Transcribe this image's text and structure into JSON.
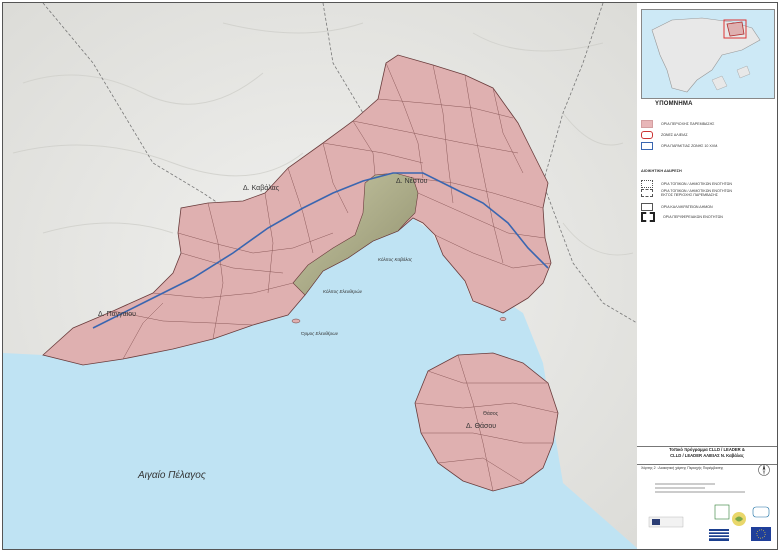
{
  "map": {
    "sea_label": "Αιγαίο Πέλαγος",
    "gulf_kavala": "Κόλπος Καβάλας",
    "gulf_eleftheron": "Κόλπος Ελευθερών",
    "gulf_pierian": "Όρμος Ελευθέρων",
    "units": [
      {
        "name": "Δ. Καβάλας"
      },
      {
        "name": "Δ. Νέστου"
      },
      {
        "name": "Δ. Παγγαίου"
      },
      {
        "name": "Δ. Θάσου"
      }
    ],
    "thasos_town": "Θάσος",
    "colors": {
      "land": "#dfb0b0",
      "sea": "#bfe3f3",
      "border": "#3a66b0",
      "relief": "#9a9a77"
    }
  },
  "legend": {
    "title": "ΥΠΟΜΝΗΜΑ",
    "items": [
      {
        "label": "ΟΡΙΑ ΠΕΡΙΟΧΗΣ ΠΑΡΕΜΒΑΣΗΣ",
        "icon": "pink-fill-swatch"
      },
      {
        "label": "ΖΩΝΕΣ ΑΛΙΕΙΑΣ",
        "icon": "fishing-zone-icon"
      },
      {
        "label": "ΟΡΙΑ ΠΑΡΑΚΤΙΑΣ ΖΩΝΗΣ 10 ΧΛΜ.",
        "icon": "blue-outline-swatch"
      }
    ],
    "admin_title": "ΔΙΟΙΚΗΤΙΚΗ ΔΙΑΙΡΕΣΗ",
    "admin_items": [
      {
        "label": "ΟΡΙΑ ΤΟΠΙΚΩΝ / ΔΗΜΟΤΙΚΩΝ ΕΝΟΤΗΤΩΝ"
      },
      {
        "label": "ΟΡΙΑ ΤΟΠΙΚΩΝ / ΔΗΜΟΤΙΚΩΝ ΕΝΟΤΗΤΩΝ ΕΚΤΟΣ ΠΕΡΙΟΧΗΣ ΠΑΡΕΜΒΑΣΗΣ"
      },
      {
        "label": "ΟΡΙΑ ΚΑΛΛΙΚΡΑΤΕΙΩΝ ΔΗΜΩΝ"
      },
      {
        "label": "ΟΡΙΑ ΠΕΡΙΦΕΡΕΙΑΚΩΝ ΕΝΟΤΗΤΩΝ"
      }
    ]
  },
  "title": {
    "line1": "Τοπικό πρόγραμμα CLLD / LEADER &",
    "line2": "CLLD / LEADER ΑΛΙΕΙΑΣ Ν. Καβάλας"
  },
  "caption": "Χάρτης 2 : Διοικητική χάρτης Περιοχής Παρέμβασης"
}
